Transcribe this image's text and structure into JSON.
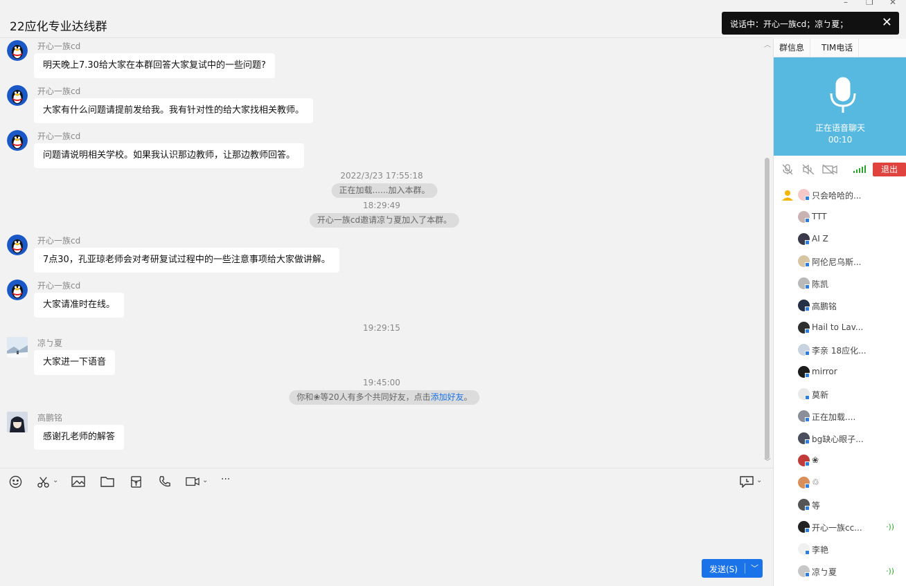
{
  "window": {
    "title": "22应化专业达线群",
    "controls": [
      "–",
      "❐",
      "✕"
    ]
  },
  "voice_toast": {
    "text": "说话中：开心一族cd；凉ㄅ夏；",
    "close": "✕"
  },
  "messages": [
    {
      "sender": "开心一族cd",
      "text": "明天晚上7.30给大家在本群回答大家复试中的一些问题?"
    },
    {
      "sender": "开心一族cd",
      "text": "大家有什么问题请提前发给我。我有针对性的给大家找相关教师。"
    },
    {
      "sender": "开心一族cd",
      "text": "问题请说明相关学校。如果我认识那边教师，让那边教师回答。"
    },
    {
      "sender": "开心一族cd",
      "text": "7点30，孔亚琼老师会对考研复试过程中的一些注意事项给大家做讲解。"
    },
    {
      "sender": "开心一族cd",
      "text": "大家请准时在线。"
    },
    {
      "sender": "凉ㄅ夏",
      "text": "大家进一下语音"
    },
    {
      "sender": "高鹏铭",
      "text": "感谢孔老师的解答"
    }
  ],
  "system": {
    "time1": "2022/3/23 17:55:18",
    "pill1": "正在加载......加入本群。",
    "time2": "18:29:49",
    "pill2": "开心一族cd邀请凉ㄅ夏加入了本群。",
    "time3": "19:29:15",
    "time4": "19:45:00",
    "pill3_prefix": "你和❀等20人有多个共同好友，点击",
    "pill3_link": "添加好友",
    "pill3_suffix": "。"
  },
  "toolbar": {
    "more": "···"
  },
  "send": {
    "label": "发送(S)"
  },
  "right_panel": {
    "tabs": [
      "群信息",
      "TIM电话"
    ],
    "voice_status": "正在语音聊天",
    "voice_timer": "00:10",
    "exit_label": "退出"
  },
  "members": [
    {
      "name": "只会哈哈的...",
      "owner": true
    },
    {
      "name": "TTT"
    },
    {
      "name": "AI  Z"
    },
    {
      "name": "阿伦尼乌斯..."
    },
    {
      "name": "陈凯"
    },
    {
      "name": "高鹏铭"
    },
    {
      "name": "Hail to Lav..."
    },
    {
      "name": "李亲 18应化..."
    },
    {
      "name": "mirror"
    },
    {
      "name": "莫新"
    },
    {
      "name": "正在加载...."
    },
    {
      "name": "bg缺心眼子..."
    },
    {
      "name": "❀"
    },
    {
      "name": "♲"
    },
    {
      "name": "等"
    },
    {
      "name": "开心一族cc...",
      "speaking": true
    },
    {
      "name": "李艳"
    },
    {
      "name": "凉ㄅ夏",
      "speaking": true
    }
  ],
  "colors": {
    "accent": "#1a73e8",
    "voice_card": "#58b9e0",
    "exit": "#e0433e",
    "speaking": "#29a329"
  }
}
